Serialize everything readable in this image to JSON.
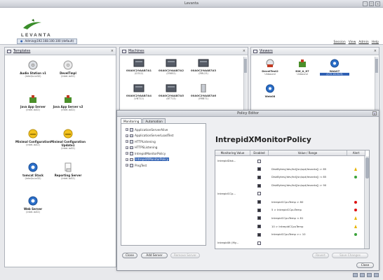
{
  "window": {
    "title": "Levanta",
    "controls": [
      "–",
      "□",
      "×"
    ]
  },
  "header": {
    "logo_text": "LEVANTA",
    "user_tab": "Admin@192.168.100.100 (default)",
    "links": [
      "Session",
      "View",
      "Admin",
      "Help"
    ]
  },
  "templates": {
    "title": "Templates",
    "items": [
      {
        "name": "Audio Station v1",
        "sub": "(intel/x-ia32)",
        "icon": "cd-icon"
      },
      {
        "name": "DevelTmpl",
        "sub": "(intel-ia32)",
        "icon": "disc-icon"
      },
      {
        "name": "Java App Server",
        "sub": "(intel-ia32)",
        "icon": "puzzle-icon"
      },
      {
        "name": "Java App Server v2",
        "sub": "(intel-ia32)",
        "icon": "puzzle-icon"
      },
      {
        "name": "Minimal Configuration",
        "sub": "(intel-ia32)",
        "icon": "smiley-icon"
      },
      {
        "name": "Minimal Configuration Update1",
        "sub": "(intel-ia32)",
        "icon": "smiley-icon"
      },
      {
        "name": "tomcat Stack",
        "sub": "(intel/x-ia32)",
        "icon": "globe-icon"
      },
      {
        "name": "Reporting Server",
        "sub": "(intel-ia32)",
        "icon": "document-icon"
      },
      {
        "name": "Web Server",
        "sub": "(intel-ia32)",
        "icon": "globe-icon"
      }
    ]
  },
  "machines": {
    "title": "Machines",
    "items": [
      {
        "name": "00A0C29AAB7A1",
        "sub": "(i2312)"
      },
      {
        "name": "00A0C29AAB7A2",
        "sub": "(E5652)"
      },
      {
        "name": "00A0C29AAB7A3",
        "sub": "(RRL23)"
      },
      {
        "name": "00A0C29AAB7A4",
        "sub": "(VNT12)"
      },
      {
        "name": "00A0C29AAB7A5",
        "sub": "(BT713)"
      },
      {
        "name": "00A0C29AAB7A6",
        "sub": "(RRB71)"
      }
    ]
  },
  "viewers": {
    "title": "Viewers",
    "items": [
      {
        "name": "DevelTest2",
        "sub": "Unbound"
      },
      {
        "name": "NW_A_87",
        "sub": "Unbound"
      },
      {
        "name": "Web07",
        "sub": "(172.16.54.9)"
      },
      {
        "name": "Web08",
        "sub": ""
      }
    ]
  },
  "dialog": {
    "title": "Policy Editor",
    "tabs": [
      "Monitoring",
      "Automation"
    ],
    "tree": [
      "ApplicationServerAlive",
      "ApplicationServerLoadTest",
      "HTTPListening",
      "HTTPSListening",
      "IntrepidMonitorPolicy",
      "IntrepidXMonitorPolicy",
      "PingTest"
    ],
    "policy_name": "IntrepidXMonitorPolicy",
    "columns": [
      "Monitoring Value",
      "Enabled",
      "Value / Range",
      "Alert"
    ],
    "rows": [
      {
        "monitor": "IntrepidDisk...",
        "checked": false,
        "range": "",
        "alert": ""
      },
      {
        "monitor": "",
        "checked": true,
        "range": "DiskBytes(/dev/hd[/sn/opt/levanta]) > 85",
        "alert": "warning"
      },
      {
        "monitor": "",
        "checked": true,
        "range": "DiskBytes(/dev/hd[/sn/opt/levanta]) < 85",
        "alert": "ok"
      },
      {
        "monitor": "",
        "checked": true,
        "range": "DiskBytes(/dev/hd[/sn/opt/levanta]) > 90",
        "alert": ""
      },
      {
        "monitor": "IntrepidCCp...",
        "checked": false,
        "range": "",
        "alert": ""
      },
      {
        "monitor": "",
        "checked": true,
        "range": "IntrepidCCpuTemp > 80",
        "alert": "critical"
      },
      {
        "monitor": "",
        "checked": true,
        "range": "5 > IntrepidCCpuTemp",
        "alert": "critical"
      },
      {
        "monitor": "",
        "checked": true,
        "range": "IntrepidCCpuTemp < 81",
        "alert": "warning"
      },
      {
        "monitor": "",
        "checked": true,
        "range": "10 > IntrepidCCpuTemp",
        "alert": "warning"
      },
      {
        "monitor": "",
        "checked": true,
        "range": "IntrepidCCpuTemp >= 10",
        "alert": "ok"
      },
      {
        "monitor": "IntrepidXt (My...",
        "checked": false,
        "range": "",
        "alert": ""
      }
    ],
    "buttons": {
      "clone": "Clone",
      "add_server": "Add Server",
      "remove": "Remove Server",
      "revert": "Revert",
      "save": "Save Changes",
      "close": "Close"
    },
    "alert_colors": {
      "critical": "#d11",
      "warning": "#e8b400",
      "ok": "#3aa33a"
    }
  }
}
